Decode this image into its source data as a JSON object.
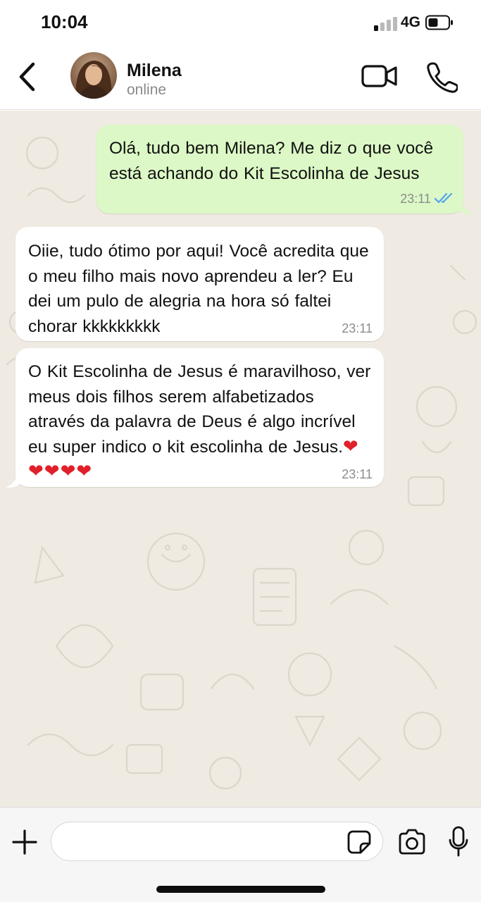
{
  "status_bar": {
    "time": "10:04",
    "network": "4G",
    "signal_bars_active": 1,
    "signal_bars_total": 4
  },
  "header": {
    "contact_name": "Milena",
    "contact_status": "online",
    "icons": [
      "back-chevron-icon",
      "avatar",
      "video-call-icon",
      "phone-icon"
    ]
  },
  "messages": [
    {
      "direction": "outgoing",
      "text": "Olá, tudo bem Milena? Me diz o que você está achando do Kit Escolinha de Jesus",
      "time": "23:11",
      "status": "read"
    },
    {
      "direction": "incoming",
      "text": "Oiie, tudo ótimo por aqui! Você acredita que o meu filho mais novo aprendeu a ler? Eu dei um pulo de alegria na hora só faltei chorar kkkkkkkkk",
      "time": "23:11"
    },
    {
      "direction": "incoming",
      "text": "O Kit Escolinha de Jesus é maravilhoso, ver meus dois filhos serem alfabetizados através da palavra de Deus é algo incrível eu super indico o kit escolinha de Jesus.",
      "emoji": "❤❤❤❤❤",
      "time": "23:11"
    }
  ],
  "composer": {
    "input_value": "",
    "icons": [
      "plus-icon",
      "sticker-icon",
      "camera-icon",
      "microphone-icon"
    ]
  },
  "colors": {
    "outgoing_bubble": "#dcf8c6",
    "incoming_bubble": "#ffffff",
    "chat_background": "#efeae2",
    "read_ticks": "#4fa3f0",
    "heart": "#e0202a"
  }
}
